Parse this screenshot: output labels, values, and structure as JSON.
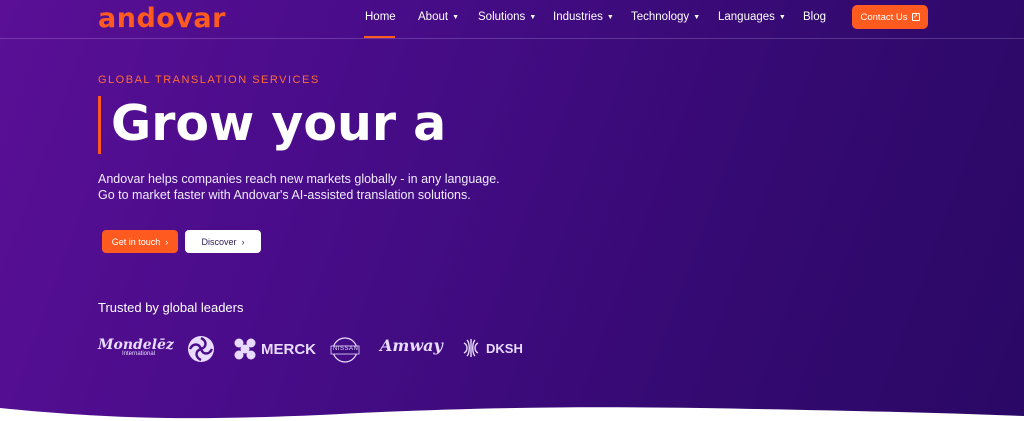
{
  "brand": {
    "logo_text": "andovar"
  },
  "nav": {
    "items": [
      {
        "label": "Home",
        "active": true,
        "has_dropdown": false
      },
      {
        "label": "About",
        "has_dropdown": true
      },
      {
        "label": "Solutions",
        "has_dropdown": true
      },
      {
        "label": "Industries",
        "has_dropdown": true
      },
      {
        "label": "Technology",
        "has_dropdown": true
      },
      {
        "label": "Languages",
        "has_dropdown": true
      },
      {
        "label": "Blog",
        "has_dropdown": false
      }
    ],
    "contact_label": "Contact Us"
  },
  "hero": {
    "eyebrow": "GLOBAL TRANSLATION SERVICES",
    "headline": "Grow your a",
    "description_lines": [
      "Andovar helps companies reach new markets globally - in any language.",
      "Go to market faster with Andovar's AI-assisted translation solutions."
    ],
    "primary_button": "Get in touch",
    "secondary_button": "Discover",
    "chevron": "›"
  },
  "trusted": {
    "title": "Trusted by global leaders",
    "logos": [
      "Mondelēz",
      "International",
      "MERCK",
      "NISSAN",
      "Amway",
      "DKSH"
    ]
  },
  "colors": {
    "accent": "#ff5a1f",
    "background_start": "#5a0f96",
    "background_end": "#2a0865"
  },
  "icons": {
    "dropdown": "chevron-down-icon",
    "contact": "external-link-icon",
    "button_arrow": "chevron-right-icon"
  }
}
